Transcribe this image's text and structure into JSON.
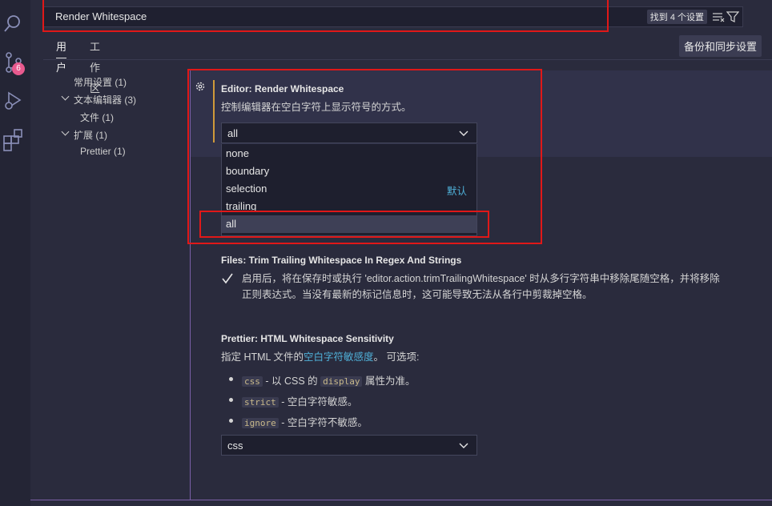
{
  "search": {
    "query": "Render Whitespace",
    "found": "找到 4 个设置"
  },
  "activity": {
    "scm_badge": "6"
  },
  "tabs": {
    "user": "用户",
    "workspace": "工作区"
  },
  "sync_button": "备份和同步设置",
  "toc": {
    "common": "常用设置 (1)",
    "text_editor": "文本编辑器 (3)",
    "files": "文件 (1)",
    "extensions": "扩展 (1)",
    "prettier": "Prettier (1)"
  },
  "render_ws": {
    "title": "Editor: Render Whitespace",
    "desc": "控制编辑器在空白字符上显示符号的方式。",
    "value": "all",
    "options": [
      "none",
      "boundary",
      "selection",
      "trailing",
      "all"
    ],
    "default_label": "默认",
    "default_option": "selection"
  },
  "trim_ws": {
    "title": "Files: Trim Trailing Whitespace In Regex And Strings",
    "line1": "启用后，将在保存时或执行 'editor.action.trimTrailingWhitespace' 时从多行字符串中移除尾随空格，并将移除",
    "line2": "正则表达式。当没有最新的标记信息时，这可能导致无法从各行中剪裁掉空格。",
    "checked": true
  },
  "prettier": {
    "title": "Prettier: HTML Whitespace Sensitivity",
    "desc_pre": "指定 HTML 文件的",
    "desc_link": "空白字符敏感度",
    "desc_post": "。 可选项:",
    "bullets": [
      {
        "code": "css",
        "text_a": " - 以 CSS 的 ",
        "code2": "display",
        "text_b": " 属性为准。"
      },
      {
        "code": "strict",
        "text_a": " - 空白字符敏感。"
      },
      {
        "code": "ignore",
        "text_a": " - 空白字符不敏感。"
      }
    ],
    "value": "css"
  }
}
